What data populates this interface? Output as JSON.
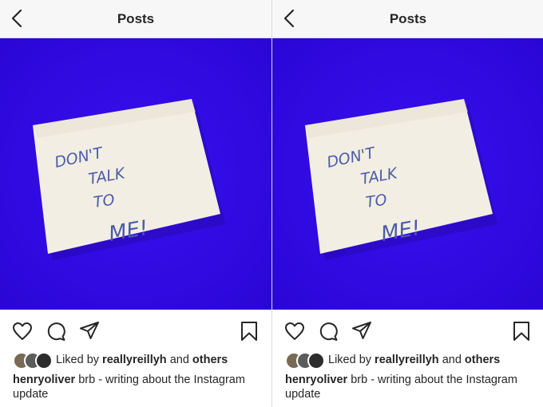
{
  "panels": [
    {
      "header": {
        "title": "Posts"
      },
      "note_text": [
        "DON'T",
        "TALK",
        "TO",
        "ME!"
      ],
      "likes": {
        "prefix": "Liked by",
        "user": "reallyreillyh",
        "and": "and",
        "others": "others"
      },
      "caption": {
        "username": "henryoliver",
        "text": "brb - writing about the Instagram update"
      }
    },
    {
      "header": {
        "title": "Posts"
      },
      "note_text": [
        "DON'T",
        "TALK",
        "TO",
        "ME!"
      ],
      "likes": {
        "prefix": "Liked by",
        "user": "reallyreillyh",
        "and": "and",
        "others": "others"
      },
      "caption": {
        "username": "henryoliver",
        "text": "brb - writing about the Instagram update"
      }
    }
  ],
  "icons": [
    "back-chevron-icon",
    "heart-icon",
    "comment-icon",
    "share-icon",
    "bookmark-icon"
  ],
  "colors": {
    "photo_background": "#2f08e8",
    "note": "#f3eee3",
    "ink": "#4b5da8"
  }
}
